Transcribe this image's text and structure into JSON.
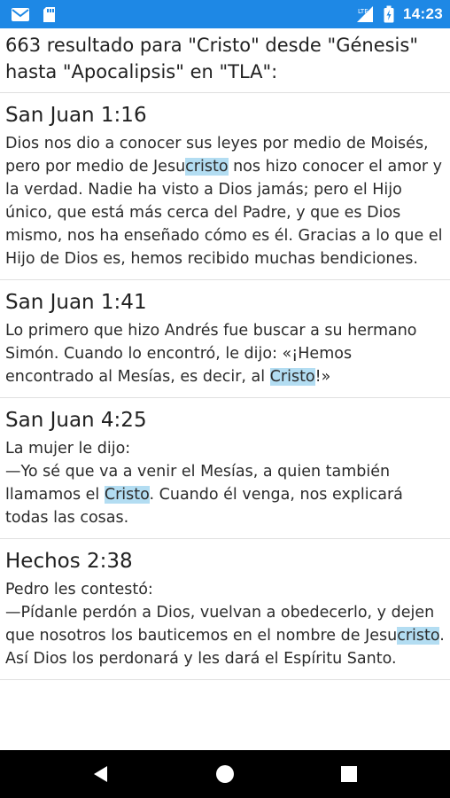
{
  "status_bar": {
    "time": "14:23",
    "icons": [
      "gmail-icon",
      "sd-card-icon",
      "signal-lte-icon",
      "battery-icon"
    ]
  },
  "search": {
    "summary": "663 resultado para \"Cristo\" desde \"Génesis\" hasta \"Apocalipsis\" en \"TLA\":"
  },
  "results": [
    {
      "reference": "San Juan 1:16",
      "segments": [
        {
          "text": "Dios nos dio a conocer sus leyes por medio de Moisés, pero por medio de Jesu",
          "hl": false
        },
        {
          "text": "cristo",
          "hl": true
        },
        {
          "text": " nos hizo conocer el amor y la verdad. Nadie ha visto a Dios jamás; pero el Hijo único, que está más cerca del Padre, y que es Dios mismo, nos ha enseñado cómo es él. Gracias a lo que el Hijo de Dios es, hemos recibido muchas bendiciones.",
          "hl": false
        }
      ]
    },
    {
      "reference": "San Juan 1:41",
      "segments": [
        {
          "text": "Lo primero que hizo Andrés fue buscar a su hermano Simón. Cuando lo encontró, le dijo: «¡Hemos encontrado al Mesías, es decir, al ",
          "hl": false
        },
        {
          "text": "Cristo",
          "hl": true
        },
        {
          "text": "!»",
          "hl": false
        }
      ]
    },
    {
      "reference": "San Juan 4:25",
      "segments": [
        {
          "text": "La mujer le dijo:\n—Yo sé que va a venir el Mesías, a quien también llamamos el ",
          "hl": false
        },
        {
          "text": "Cristo",
          "hl": true
        },
        {
          "text": ". Cuando él venga, nos explicará todas las cosas.",
          "hl": false
        }
      ]
    },
    {
      "reference": "Hechos 2:38",
      "segments": [
        {
          "text": "Pedro les contestó:\n—Pídanle perdón a Dios, vuelvan a obedecerlo, y dejen que nosotros los bauticemos en el nombre de Jesu",
          "hl": false
        },
        {
          "text": "cristo",
          "hl": true
        },
        {
          "text": ". Así Dios los perdonará y les dará el Espíritu Santo.",
          "hl": false
        }
      ]
    }
  ],
  "nav_bar": {
    "buttons": [
      "back-icon",
      "home-icon",
      "recents-icon"
    ]
  },
  "colors": {
    "status_bar": "#1e88e5",
    "highlight": "#b3ddf2",
    "nav_bar": "#000000"
  }
}
